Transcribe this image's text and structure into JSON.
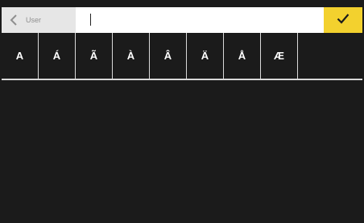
{
  "input_bar": {
    "back_label": "User",
    "text_value": "",
    "back_icon": "chevron-left-icon",
    "confirm_icon": "checkmark-icon"
  },
  "char_row": {
    "keys": [
      "A",
      "Á",
      "Ã",
      "À",
      "Â",
      "Ä",
      "Å",
      "Æ",
      ""
    ]
  },
  "colors": {
    "background": "#1b1b1b",
    "accent": "#f3d12e",
    "divider": "#d9d9d9",
    "back_button_bg": "#e6e6e6"
  }
}
